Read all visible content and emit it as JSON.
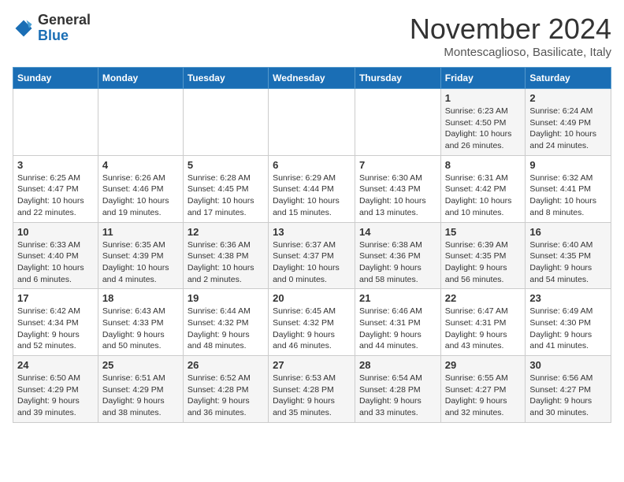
{
  "header": {
    "logo_general": "General",
    "logo_blue": "Blue",
    "month_title": "November 2024",
    "location": "Montescaglioso, Basilicate, Italy"
  },
  "weekdays": [
    "Sunday",
    "Monday",
    "Tuesday",
    "Wednesday",
    "Thursday",
    "Friday",
    "Saturday"
  ],
  "weeks": [
    [
      {
        "day": "",
        "info": ""
      },
      {
        "day": "",
        "info": ""
      },
      {
        "day": "",
        "info": ""
      },
      {
        "day": "",
        "info": ""
      },
      {
        "day": "",
        "info": ""
      },
      {
        "day": "1",
        "info": "Sunrise: 6:23 AM\nSunset: 4:50 PM\nDaylight: 10 hours and 26 minutes."
      },
      {
        "day": "2",
        "info": "Sunrise: 6:24 AM\nSunset: 4:49 PM\nDaylight: 10 hours and 24 minutes."
      }
    ],
    [
      {
        "day": "3",
        "info": "Sunrise: 6:25 AM\nSunset: 4:47 PM\nDaylight: 10 hours and 22 minutes."
      },
      {
        "day": "4",
        "info": "Sunrise: 6:26 AM\nSunset: 4:46 PM\nDaylight: 10 hours and 19 minutes."
      },
      {
        "day": "5",
        "info": "Sunrise: 6:28 AM\nSunset: 4:45 PM\nDaylight: 10 hours and 17 minutes."
      },
      {
        "day": "6",
        "info": "Sunrise: 6:29 AM\nSunset: 4:44 PM\nDaylight: 10 hours and 15 minutes."
      },
      {
        "day": "7",
        "info": "Sunrise: 6:30 AM\nSunset: 4:43 PM\nDaylight: 10 hours and 13 minutes."
      },
      {
        "day": "8",
        "info": "Sunrise: 6:31 AM\nSunset: 4:42 PM\nDaylight: 10 hours and 10 minutes."
      },
      {
        "day": "9",
        "info": "Sunrise: 6:32 AM\nSunset: 4:41 PM\nDaylight: 10 hours and 8 minutes."
      }
    ],
    [
      {
        "day": "10",
        "info": "Sunrise: 6:33 AM\nSunset: 4:40 PM\nDaylight: 10 hours and 6 minutes."
      },
      {
        "day": "11",
        "info": "Sunrise: 6:35 AM\nSunset: 4:39 PM\nDaylight: 10 hours and 4 minutes."
      },
      {
        "day": "12",
        "info": "Sunrise: 6:36 AM\nSunset: 4:38 PM\nDaylight: 10 hours and 2 minutes."
      },
      {
        "day": "13",
        "info": "Sunrise: 6:37 AM\nSunset: 4:37 PM\nDaylight: 10 hours and 0 minutes."
      },
      {
        "day": "14",
        "info": "Sunrise: 6:38 AM\nSunset: 4:36 PM\nDaylight: 9 hours and 58 minutes."
      },
      {
        "day": "15",
        "info": "Sunrise: 6:39 AM\nSunset: 4:35 PM\nDaylight: 9 hours and 56 minutes."
      },
      {
        "day": "16",
        "info": "Sunrise: 6:40 AM\nSunset: 4:35 PM\nDaylight: 9 hours and 54 minutes."
      }
    ],
    [
      {
        "day": "17",
        "info": "Sunrise: 6:42 AM\nSunset: 4:34 PM\nDaylight: 9 hours and 52 minutes."
      },
      {
        "day": "18",
        "info": "Sunrise: 6:43 AM\nSunset: 4:33 PM\nDaylight: 9 hours and 50 minutes."
      },
      {
        "day": "19",
        "info": "Sunrise: 6:44 AM\nSunset: 4:32 PM\nDaylight: 9 hours and 48 minutes."
      },
      {
        "day": "20",
        "info": "Sunrise: 6:45 AM\nSunset: 4:32 PM\nDaylight: 9 hours and 46 minutes."
      },
      {
        "day": "21",
        "info": "Sunrise: 6:46 AM\nSunset: 4:31 PM\nDaylight: 9 hours and 44 minutes."
      },
      {
        "day": "22",
        "info": "Sunrise: 6:47 AM\nSunset: 4:31 PM\nDaylight: 9 hours and 43 minutes."
      },
      {
        "day": "23",
        "info": "Sunrise: 6:49 AM\nSunset: 4:30 PM\nDaylight: 9 hours and 41 minutes."
      }
    ],
    [
      {
        "day": "24",
        "info": "Sunrise: 6:50 AM\nSunset: 4:29 PM\nDaylight: 9 hours and 39 minutes."
      },
      {
        "day": "25",
        "info": "Sunrise: 6:51 AM\nSunset: 4:29 PM\nDaylight: 9 hours and 38 minutes."
      },
      {
        "day": "26",
        "info": "Sunrise: 6:52 AM\nSunset: 4:28 PM\nDaylight: 9 hours and 36 minutes."
      },
      {
        "day": "27",
        "info": "Sunrise: 6:53 AM\nSunset: 4:28 PM\nDaylight: 9 hours and 35 minutes."
      },
      {
        "day": "28",
        "info": "Sunrise: 6:54 AM\nSunset: 4:28 PM\nDaylight: 9 hours and 33 minutes."
      },
      {
        "day": "29",
        "info": "Sunrise: 6:55 AM\nSunset: 4:27 PM\nDaylight: 9 hours and 32 minutes."
      },
      {
        "day": "30",
        "info": "Sunrise: 6:56 AM\nSunset: 4:27 PM\nDaylight: 9 hours and 30 minutes."
      }
    ]
  ]
}
